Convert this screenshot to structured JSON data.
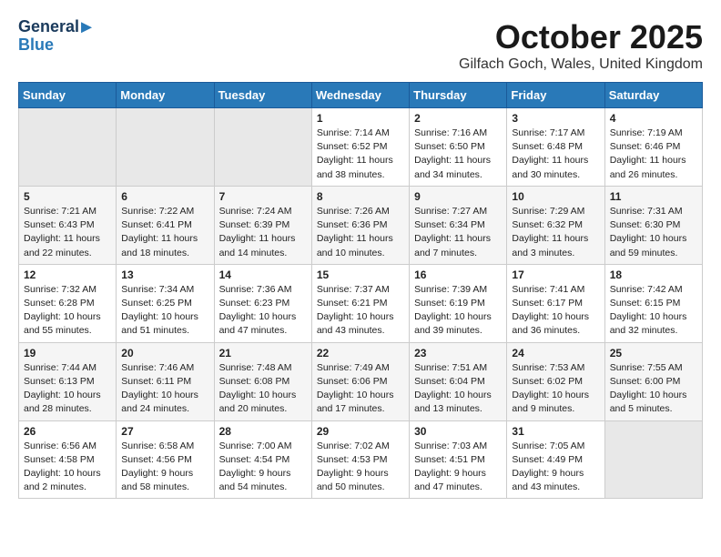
{
  "header": {
    "logo_line1": "General",
    "logo_line2": "Blue",
    "title": "October 2025",
    "subtitle": "Gilfach Goch, Wales, United Kingdom"
  },
  "days_of_week": [
    "Sunday",
    "Monday",
    "Tuesday",
    "Wednesday",
    "Thursday",
    "Friday",
    "Saturday"
  ],
  "weeks": [
    [
      {
        "day": "",
        "info": ""
      },
      {
        "day": "",
        "info": ""
      },
      {
        "day": "",
        "info": ""
      },
      {
        "day": "1",
        "info": "Sunrise: 7:14 AM\nSunset: 6:52 PM\nDaylight: 11 hours and 38 minutes."
      },
      {
        "day": "2",
        "info": "Sunrise: 7:16 AM\nSunset: 6:50 PM\nDaylight: 11 hours and 34 minutes."
      },
      {
        "day": "3",
        "info": "Sunrise: 7:17 AM\nSunset: 6:48 PM\nDaylight: 11 hours and 30 minutes."
      },
      {
        "day": "4",
        "info": "Sunrise: 7:19 AM\nSunset: 6:46 PM\nDaylight: 11 hours and 26 minutes."
      }
    ],
    [
      {
        "day": "5",
        "info": "Sunrise: 7:21 AM\nSunset: 6:43 PM\nDaylight: 11 hours and 22 minutes."
      },
      {
        "day": "6",
        "info": "Sunrise: 7:22 AM\nSunset: 6:41 PM\nDaylight: 11 hours and 18 minutes."
      },
      {
        "day": "7",
        "info": "Sunrise: 7:24 AM\nSunset: 6:39 PM\nDaylight: 11 hours and 14 minutes."
      },
      {
        "day": "8",
        "info": "Sunrise: 7:26 AM\nSunset: 6:36 PM\nDaylight: 11 hours and 10 minutes."
      },
      {
        "day": "9",
        "info": "Sunrise: 7:27 AM\nSunset: 6:34 PM\nDaylight: 11 hours and 7 minutes."
      },
      {
        "day": "10",
        "info": "Sunrise: 7:29 AM\nSunset: 6:32 PM\nDaylight: 11 hours and 3 minutes."
      },
      {
        "day": "11",
        "info": "Sunrise: 7:31 AM\nSunset: 6:30 PM\nDaylight: 10 hours and 59 minutes."
      }
    ],
    [
      {
        "day": "12",
        "info": "Sunrise: 7:32 AM\nSunset: 6:28 PM\nDaylight: 10 hours and 55 minutes."
      },
      {
        "day": "13",
        "info": "Sunrise: 7:34 AM\nSunset: 6:25 PM\nDaylight: 10 hours and 51 minutes."
      },
      {
        "day": "14",
        "info": "Sunrise: 7:36 AM\nSunset: 6:23 PM\nDaylight: 10 hours and 47 minutes."
      },
      {
        "day": "15",
        "info": "Sunrise: 7:37 AM\nSunset: 6:21 PM\nDaylight: 10 hours and 43 minutes."
      },
      {
        "day": "16",
        "info": "Sunrise: 7:39 AM\nSunset: 6:19 PM\nDaylight: 10 hours and 39 minutes."
      },
      {
        "day": "17",
        "info": "Sunrise: 7:41 AM\nSunset: 6:17 PM\nDaylight: 10 hours and 36 minutes."
      },
      {
        "day": "18",
        "info": "Sunrise: 7:42 AM\nSunset: 6:15 PM\nDaylight: 10 hours and 32 minutes."
      }
    ],
    [
      {
        "day": "19",
        "info": "Sunrise: 7:44 AM\nSunset: 6:13 PM\nDaylight: 10 hours and 28 minutes."
      },
      {
        "day": "20",
        "info": "Sunrise: 7:46 AM\nSunset: 6:11 PM\nDaylight: 10 hours and 24 minutes."
      },
      {
        "day": "21",
        "info": "Sunrise: 7:48 AM\nSunset: 6:08 PM\nDaylight: 10 hours and 20 minutes."
      },
      {
        "day": "22",
        "info": "Sunrise: 7:49 AM\nSunset: 6:06 PM\nDaylight: 10 hours and 17 minutes."
      },
      {
        "day": "23",
        "info": "Sunrise: 7:51 AM\nSunset: 6:04 PM\nDaylight: 10 hours and 13 minutes."
      },
      {
        "day": "24",
        "info": "Sunrise: 7:53 AM\nSunset: 6:02 PM\nDaylight: 10 hours and 9 minutes."
      },
      {
        "day": "25",
        "info": "Sunrise: 7:55 AM\nSunset: 6:00 PM\nDaylight: 10 hours and 5 minutes."
      }
    ],
    [
      {
        "day": "26",
        "info": "Sunrise: 6:56 AM\nSunset: 4:58 PM\nDaylight: 10 hours and 2 minutes."
      },
      {
        "day": "27",
        "info": "Sunrise: 6:58 AM\nSunset: 4:56 PM\nDaylight: 9 hours and 58 minutes."
      },
      {
        "day": "28",
        "info": "Sunrise: 7:00 AM\nSunset: 4:54 PM\nDaylight: 9 hours and 54 minutes."
      },
      {
        "day": "29",
        "info": "Sunrise: 7:02 AM\nSunset: 4:53 PM\nDaylight: 9 hours and 50 minutes."
      },
      {
        "day": "30",
        "info": "Sunrise: 7:03 AM\nSunset: 4:51 PM\nDaylight: 9 hours and 47 minutes."
      },
      {
        "day": "31",
        "info": "Sunrise: 7:05 AM\nSunset: 4:49 PM\nDaylight: 9 hours and 43 minutes."
      },
      {
        "day": "",
        "info": ""
      }
    ]
  ]
}
